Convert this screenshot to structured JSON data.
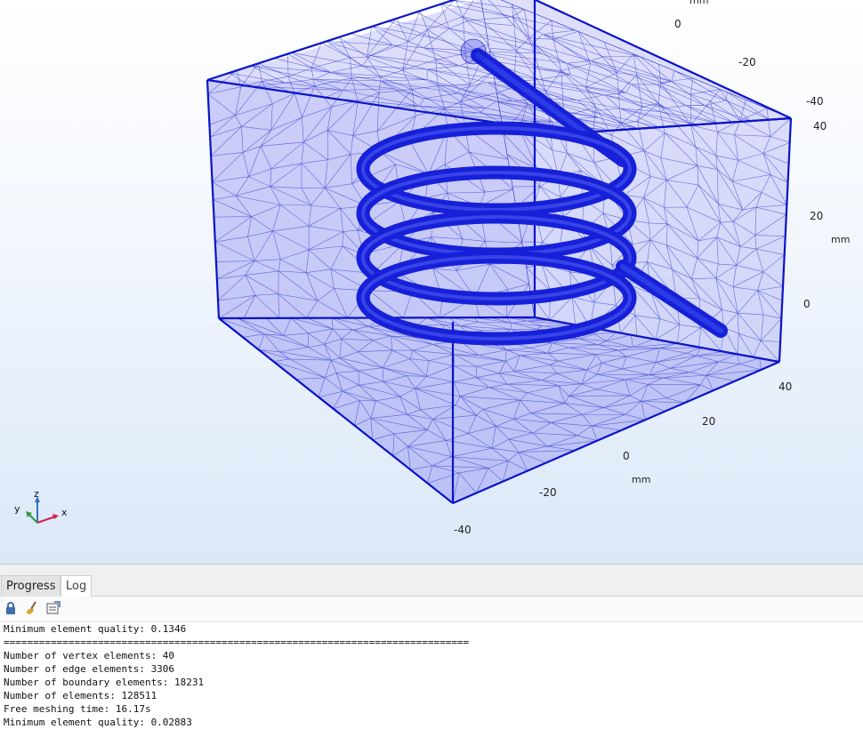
{
  "viewport": {
    "axis_unit": "mm",
    "top_axis_ticks": [
      "0",
      "-20",
      "-40"
    ],
    "right_axis_ticks": [
      "40",
      "20",
      "0"
    ],
    "bottom_axis_ticks": [
      "40",
      "20",
      "0",
      "-20",
      "-40"
    ],
    "triad": {
      "z": "z",
      "y": "y",
      "x": "x"
    },
    "colors": {
      "mesh": "#0a14c8",
      "face_fill": "#8c8cf0",
      "background_bottom": "#dbe8f8"
    }
  },
  "panel": {
    "tabs": [
      {
        "label": "Progress",
        "active": false
      },
      {
        "label": "Log",
        "active": true
      }
    ],
    "toolbar_icons": [
      "lock-icon",
      "clear-broom-icon",
      "export-log-icon"
    ],
    "log_lines": [
      "Minimum element quality: 0.1346",
      "===============================================================================",
      "Number of vertex elements: 40",
      "Number of edge elements: 3306",
      "Number of boundary elements: 18231",
      "Number of elements: 128511",
      "Free meshing time: 16.17s",
      "Minimum element quality: 0.02883"
    ]
  }
}
